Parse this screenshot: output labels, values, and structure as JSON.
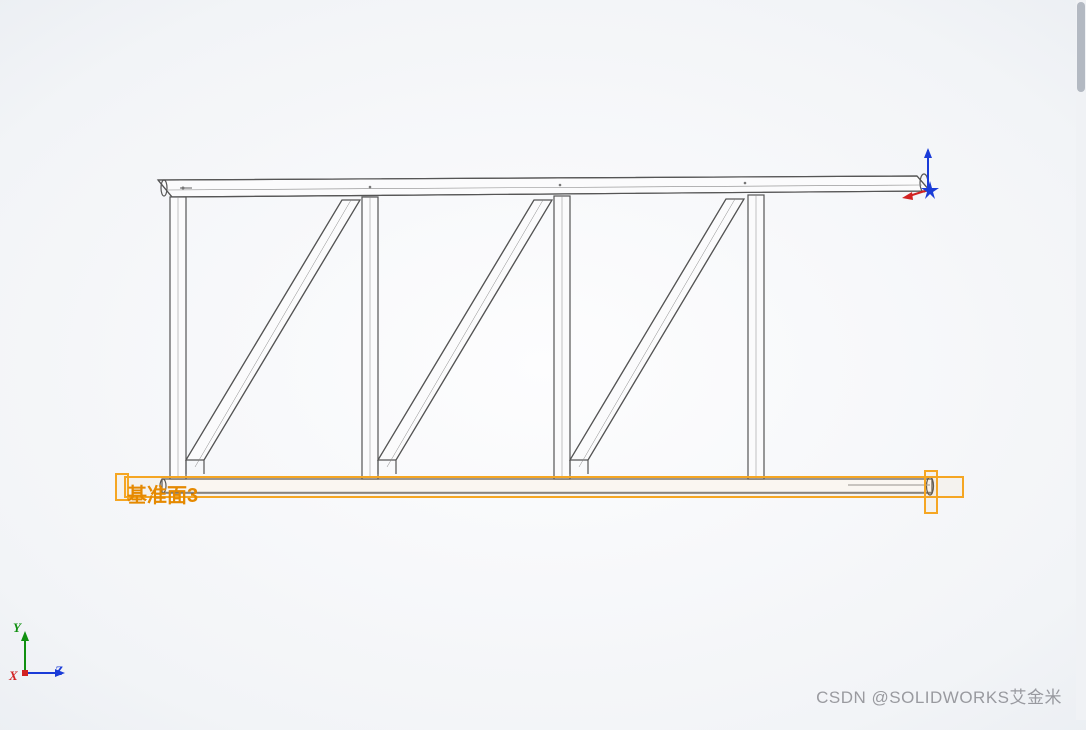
{
  "plane": {
    "label": "基准面3"
  },
  "triad": {
    "x": "X",
    "y": "Y",
    "z": "Z"
  },
  "watermark": "CSDN @SOLIDWORKS艾金米",
  "axis_colors": {
    "x": "#d22222",
    "y": "#109010",
    "z": "#1a3cd8",
    "origin_star": "#1a3cd8"
  }
}
